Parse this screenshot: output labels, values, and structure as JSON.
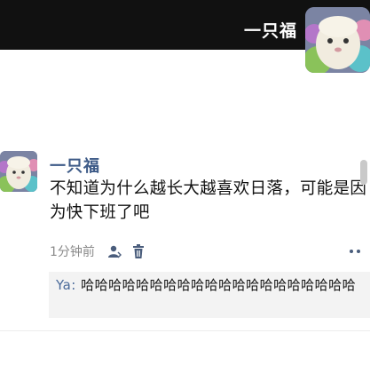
{
  "header": {
    "name": "一只福",
    "avatar_icon": "fluffy-pet-avatar-icon"
  },
  "post": {
    "avatar_icon": "fluffy-pet-avatar-icon",
    "author": "一只福",
    "text": "不知道为什么越长大越喜欢日落，可能是因为快下班了吧",
    "time": "1分钟前",
    "icons": [
      "person-icon",
      "trash-icon",
      "more-icon"
    ]
  },
  "comment": {
    "commenter": "Ya:",
    "text": "哈哈哈哈哈哈哈哈哈哈哈哈哈哈哈哈哈哈哈哈"
  },
  "colors": {
    "header_bg": "#111111",
    "link_blue": "#3d5a87",
    "comment_bg": "#f3f3f3"
  }
}
